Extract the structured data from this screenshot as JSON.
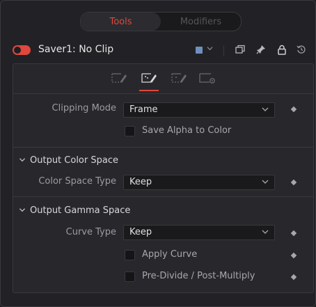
{
  "tabs": {
    "tools": "Tools",
    "modifiers": "Modifiers"
  },
  "header": {
    "title": "Saver1: No Clip",
    "swatch_color": "#6f8fbf",
    "icons": [
      "color-swatch-icon",
      "chevron-down-icon",
      "duplicate-icon",
      "pin-icon",
      "lock-icon",
      "reset-icon"
    ]
  },
  "icon_tabs": {
    "items": [
      "file-tab-icon",
      "format-tab-icon",
      "audio-tab-icon",
      "settings-tab-icon"
    ],
    "active_index": 1
  },
  "clipping": {
    "label": "Clipping Mode",
    "value": "Frame",
    "save_alpha_label": "Save Alpha to Color",
    "save_alpha_checked": false
  },
  "output_color_space": {
    "header": "Output Color Space",
    "type_label": "Color Space Type",
    "type_value": "Keep"
  },
  "output_gamma_space": {
    "header": "Output Gamma Space",
    "curve_label": "Curve Type",
    "curve_value": "Keep",
    "apply_curve_label": "Apply Curve",
    "apply_curve_checked": false,
    "predivide_label": "Pre-Divide / Post-Multiply",
    "predivide_checked": false
  },
  "colors": {
    "accent": "#e0473d",
    "panel_bg": "#28282c",
    "window_bg": "#222226"
  }
}
